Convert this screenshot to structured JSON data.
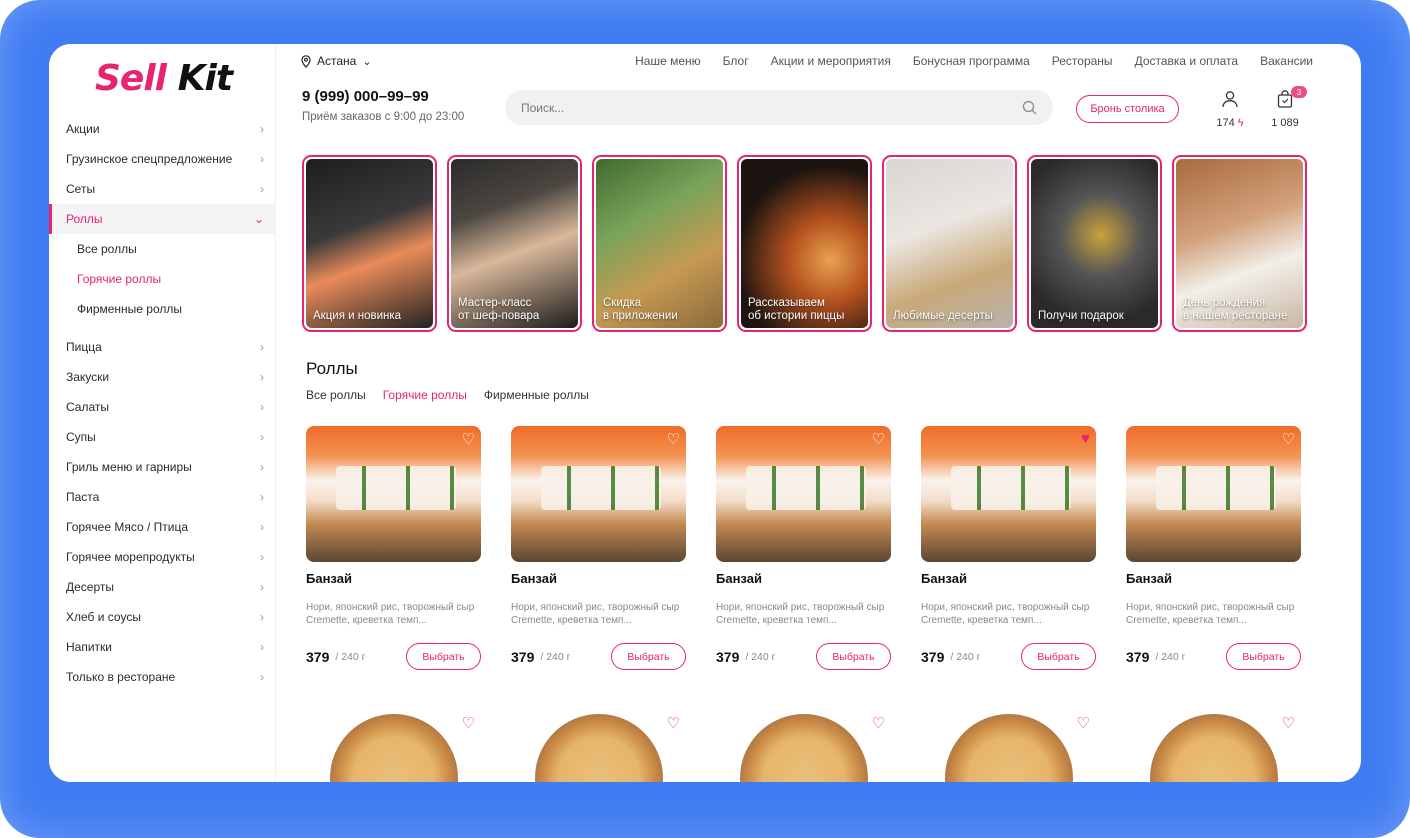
{
  "brand": {
    "part1": "Sell",
    "part2": "Kit"
  },
  "sidebar": {
    "items_top": [
      {
        "label": "Акции"
      },
      {
        "label": "Грузинское спецпредложение"
      },
      {
        "label": "Сеты"
      }
    ],
    "active": {
      "label": "Роллы"
    },
    "sub": [
      {
        "label": "Все роллы"
      },
      {
        "label": "Горячие роллы"
      },
      {
        "label": "Фирменные роллы"
      }
    ],
    "items_bottom": [
      {
        "label": "Пицца"
      },
      {
        "label": "Закуски"
      },
      {
        "label": "Салаты"
      },
      {
        "label": "Супы"
      },
      {
        "label": "Гриль меню и гарниры"
      },
      {
        "label": "Паста"
      },
      {
        "label": "Горячее Мясо / Птица"
      },
      {
        "label": "Горячее морепродукты"
      },
      {
        "label": "Десерты"
      },
      {
        "label": "Хлеб и соусы"
      },
      {
        "label": "Напитки"
      },
      {
        "label": "Только в ресторане"
      }
    ]
  },
  "header": {
    "city": "Астана",
    "nav": [
      "Наше меню",
      "Блог",
      "Акции и мероприятия",
      "Бонусная программа",
      "Рестораны",
      "Доставка и оплата",
      "Вакансии"
    ],
    "phone": "9 (999) 000–99–99",
    "hours": "Приём заказов с 9:00 до 23:00",
    "search_placeholder": "Поиск...",
    "book_label": "Бронь столика",
    "bonus": "174",
    "cart_total": "1 089",
    "cart_count": "3"
  },
  "stories": [
    {
      "label": "Акция и новинка"
    },
    {
      "label": "Мастер-класс\nот шеф-повара"
    },
    {
      "label": "Скидка\nв приложении"
    },
    {
      "label": "Рассказываем\nоб истории пиццы"
    },
    {
      "label": "Любимые десерты"
    },
    {
      "label": "Получи подарок"
    },
    {
      "label": "День рождения\nв нашем ресторане"
    }
  ],
  "section": {
    "title": "Роллы",
    "tabs": [
      "Все роллы",
      "Горячие роллы",
      "Фирменные роллы"
    ]
  },
  "products": [
    {
      "name": "Банзай",
      "desc": "Нори, японский рис, творожный сыр Cremette, креветка темп...",
      "price": "379",
      "weight": "/ 240 г",
      "button": "Выбрать",
      "favorite": false
    },
    {
      "name": "Банзай",
      "desc": "Нори, японский рис, творожный сыр Cremette, креветка темп...",
      "price": "379",
      "weight": "/ 240 г",
      "button": "Выбрать",
      "favorite": false
    },
    {
      "name": "Банзай",
      "desc": "Нори, японский рис, творожный сыр Cremette, креветка темп...",
      "price": "379",
      "weight": "/ 240 г",
      "button": "Выбрать",
      "favorite": false
    },
    {
      "name": "Банзай",
      "desc": "Нори, японский рис, творожный сыр Cremette, креветка темп...",
      "price": "379",
      "weight": "/ 240 г",
      "button": "Выбрать",
      "favorite": true
    },
    {
      "name": "Банзай",
      "desc": "Нори, японский рис, творожный сыр Cremette, креветка темп...",
      "price": "379",
      "weight": "/ 240 г",
      "button": "Выбрать",
      "favorite": false
    }
  ],
  "colors": {
    "accent": "#e6246f",
    "frame": "#3f7cf2"
  }
}
